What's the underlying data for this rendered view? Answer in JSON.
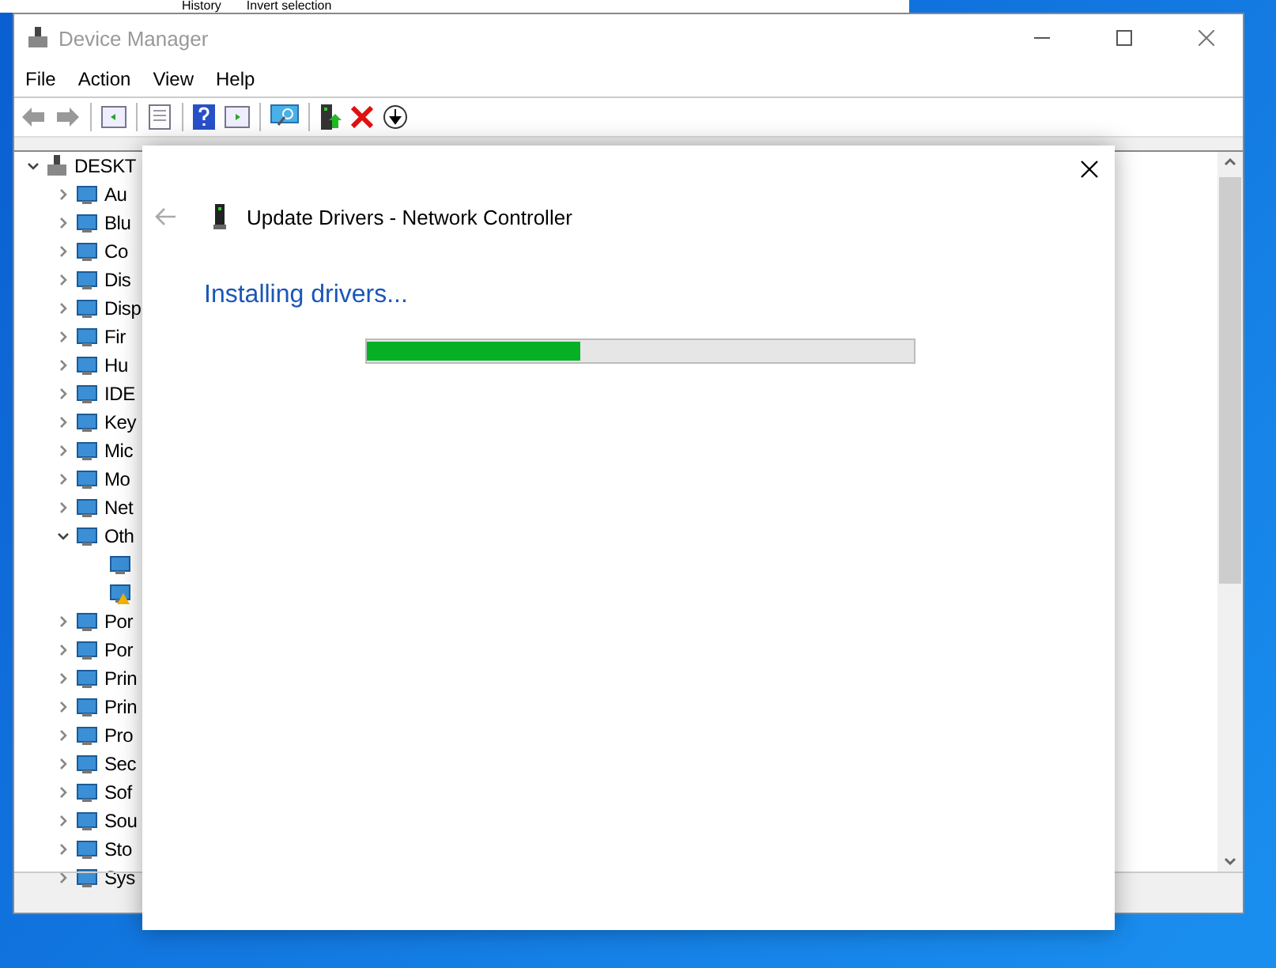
{
  "background_window": {
    "items": [
      "History",
      "Invert selection"
    ]
  },
  "window": {
    "title": "Device Manager"
  },
  "menu": [
    "File",
    "Action",
    "View",
    "Help"
  ],
  "tree": {
    "label": "DESKT",
    "expanded": true,
    "children": [
      {
        "label": "Au",
        "expanded": false
      },
      {
        "label": "Blu",
        "expanded": false
      },
      {
        "label": "Co",
        "expanded": false
      },
      {
        "label": "Dis",
        "expanded": false
      },
      {
        "label": "Disp",
        "expanded": false
      },
      {
        "label": "Fir",
        "expanded": false
      },
      {
        "label": "Hu",
        "expanded": false
      },
      {
        "label": "IDE",
        "expanded": false
      },
      {
        "label": "Key",
        "expanded": false
      },
      {
        "label": "Mic",
        "expanded": false
      },
      {
        "label": "Mo",
        "expanded": false
      },
      {
        "label": "Net",
        "expanded": false
      },
      {
        "label": "Oth",
        "expanded": true,
        "children": [
          {
            "warning": false
          },
          {
            "warning": true
          }
        ]
      },
      {
        "label": "Por",
        "expanded": false
      },
      {
        "label": "Por",
        "expanded": false
      },
      {
        "label": "Prin",
        "expanded": false
      },
      {
        "label": "Prin",
        "expanded": false
      },
      {
        "label": "Pro",
        "expanded": false
      },
      {
        "label": "Sec",
        "expanded": false
      },
      {
        "label": "Sof",
        "expanded": false
      },
      {
        "label": "Sou",
        "expanded": false
      },
      {
        "label": "Sto",
        "expanded": false
      },
      {
        "label": "Sys",
        "expanded": false
      }
    ]
  },
  "dialog": {
    "title": "Update Drivers - Network Controller",
    "heading": "Installing drivers...",
    "level": 0.39
  }
}
